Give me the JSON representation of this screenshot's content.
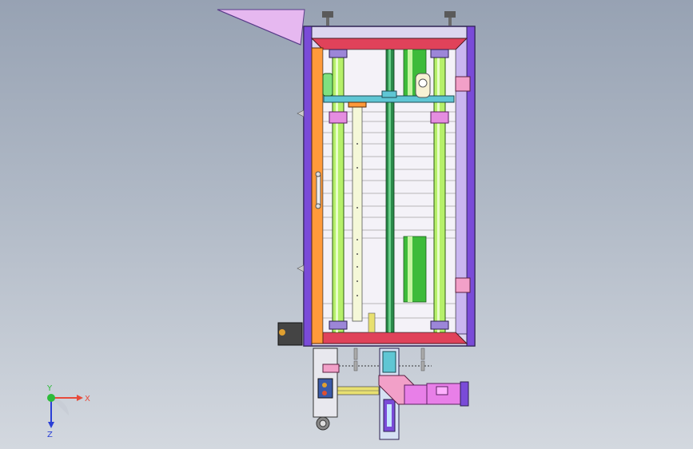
{
  "viewport": {
    "background_top": "#97a2b3",
    "background_bottom": "#d3d8df"
  },
  "model": {
    "frame_color": "#7a4bd8",
    "panel_color": "#f5f3f8",
    "rail_color": "#b6f06a",
    "screw_color": "#2a8a4a",
    "accent_red": "#e0425a",
    "accent_orange": "#ff9a3a",
    "accent_pink": "#e58de0",
    "motor_color": "#e87fe8"
  },
  "triad": {
    "x_label": "X",
    "y_label": "Y",
    "z_label": "Z",
    "x_color": "#e84a3a",
    "y_color": "#2dbb3a",
    "z_color": "#2a3fd6"
  }
}
